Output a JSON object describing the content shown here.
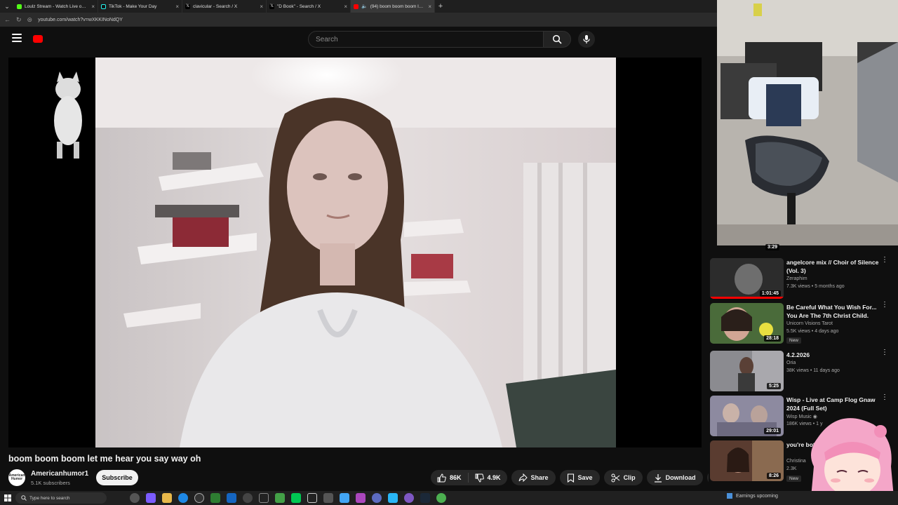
{
  "browser": {
    "tabs": [
      {
        "title": "Loulz Stream - Watch Live on Kick",
        "favicon_color": "#53fc18",
        "active": false
      },
      {
        "title": "TikTok - Make Your Day",
        "favicon_color": "#ffffff",
        "active": false
      },
      {
        "title": "clavicular - Search / X",
        "favicon_color": "#ffffff",
        "active": false
      },
      {
        "title": "\"D Book\" - Search / X",
        "favicon_color": "#ffffff",
        "active": false
      },
      {
        "title": "(94) boom boom boom let m",
        "favicon_color": "#ff0000",
        "active": true
      }
    ],
    "url": "youtube.com/watch?v=wXKKINoNdQY"
  },
  "youtube": {
    "search_placeholder": "Search",
    "video": {
      "title": "boom boom boom let me hear you say way oh",
      "channel": "Americanhumor1",
      "channel_avatar_text": "American Humor",
      "subscribers": "5.1K subscribers",
      "subscribe_label": "Subscribe",
      "likes": "86K",
      "dislikes": "4.9K",
      "share_label": "Share",
      "save_label": "Save",
      "clip_label": "Clip",
      "download_label": "Download"
    },
    "top_duration": "3:29",
    "recommendations": [
      {
        "title": "angelcore mix // Choir of Silence (Vol. 3)",
        "channel": "Zeraphim",
        "meta": "7.3K views • 5 months ago",
        "duration": "1:01:45",
        "badge": "",
        "thumb": "#3a3a3a"
      },
      {
        "title": "Be Careful What You Wish For... You Are The 7th Christ Child.",
        "channel": "Unicorn Visions Tarot",
        "meta": "5.5K views • 4 days ago",
        "duration": "28:18",
        "badge": "New",
        "thumb": "#4a6b3a"
      },
      {
        "title": "4.2.2026",
        "channel": "Oria",
        "meta": "38K views • 11 days ago",
        "duration": "5:25",
        "badge": "",
        "thumb": "#7a7a80"
      },
      {
        "title": "Wisp - Live at Camp Flog Gnaw 2024 (Full Set)",
        "channel": "Wisp Music ◉",
        "meta": "186K views • 1 y",
        "duration": "29:01",
        "badge": "",
        "thumb": "#8d8aa0"
      },
      {
        "title": "you're bot... others fe...",
        "channel": "Christina",
        "meta": "2.3K",
        "duration": "8:26",
        "badge": "New",
        "thumb": "#5a3c30"
      }
    ]
  },
  "taskbar": {
    "search_placeholder": "Type here to search",
    "tray_text": "Earnings upcoming"
  }
}
